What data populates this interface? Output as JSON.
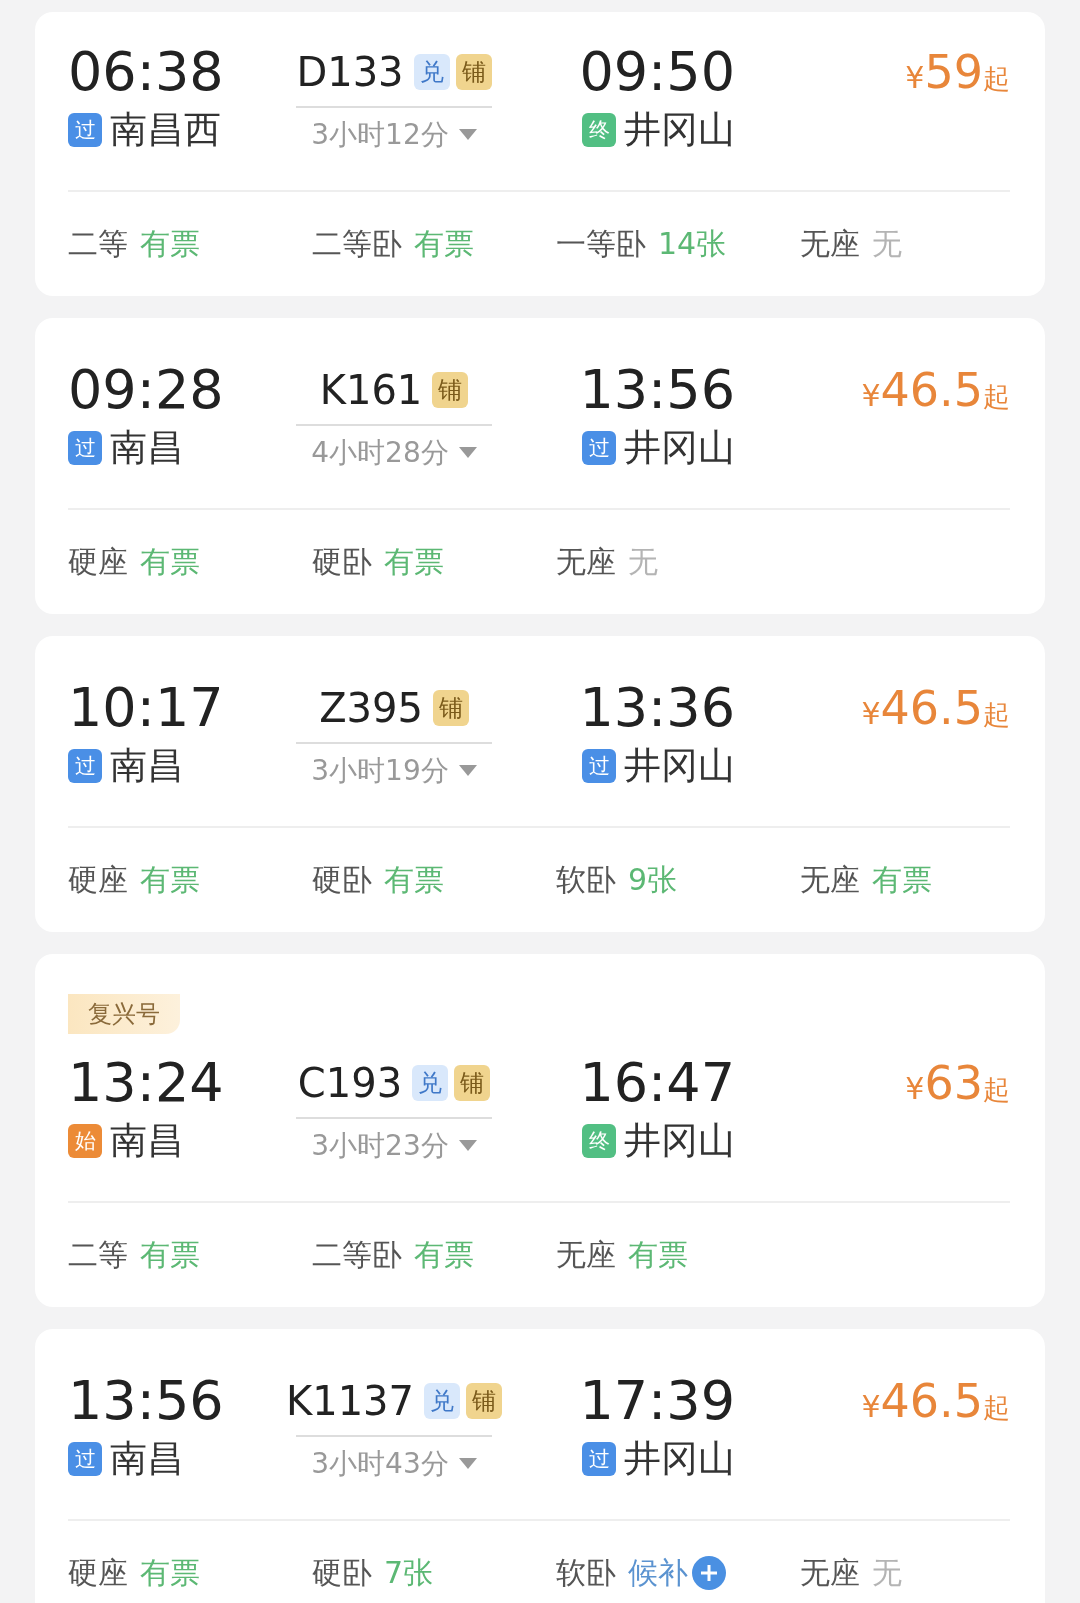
{
  "trains": [
    {
      "depart": "06:38",
      "from": {
        "tag": "过",
        "kind": "pass",
        "name": "南昌西"
      },
      "number": "D133",
      "tags": [
        {
          "text": "兑",
          "kind": "exchange"
        },
        {
          "text": "铺",
          "kind": "berth"
        }
      ],
      "duration": "3小时12分",
      "arrive": "09:50",
      "to": {
        "tag": "终",
        "kind": "terminal",
        "name": "井冈山"
      },
      "price": {
        "currency": "¥",
        "amount": "59",
        "suffix": "起"
      },
      "seats": [
        {
          "class": "二等",
          "status": "有票",
          "kind": "available"
        },
        {
          "class": "二等卧",
          "status": "有票",
          "kind": "available"
        },
        {
          "class": "一等卧",
          "status": "14张",
          "kind": "available"
        },
        {
          "class": "无座",
          "status": "无",
          "kind": "none"
        }
      ]
    },
    {
      "depart": "09:28",
      "from": {
        "tag": "过",
        "kind": "pass",
        "name": "南昌"
      },
      "number": "K161",
      "tags": [
        {
          "text": "铺",
          "kind": "berth"
        }
      ],
      "duration": "4小时28分",
      "arrive": "13:56",
      "to": {
        "tag": "过",
        "kind": "pass",
        "name": "井冈山"
      },
      "price": {
        "currency": "¥",
        "amount": "46.5",
        "suffix": "起"
      },
      "seats": [
        {
          "class": "硬座",
          "status": "有票",
          "kind": "available"
        },
        {
          "class": "硬卧",
          "status": "有票",
          "kind": "available"
        },
        {
          "class": "无座",
          "status": "无",
          "kind": "none"
        }
      ]
    },
    {
      "depart": "10:17",
      "from": {
        "tag": "过",
        "kind": "pass",
        "name": "南昌"
      },
      "number": "Z395",
      "tags": [
        {
          "text": "铺",
          "kind": "berth"
        }
      ],
      "duration": "3小时19分",
      "arrive": "13:36",
      "to": {
        "tag": "过",
        "kind": "pass",
        "name": "井冈山"
      },
      "price": {
        "currency": "¥",
        "amount": "46.5",
        "suffix": "起"
      },
      "seats": [
        {
          "class": "硬座",
          "status": "有票",
          "kind": "available"
        },
        {
          "class": "硬卧",
          "status": "有票",
          "kind": "available"
        },
        {
          "class": "软卧",
          "status": "9张",
          "kind": "available"
        },
        {
          "class": "无座",
          "status": "有票",
          "kind": "available"
        }
      ]
    },
    {
      "badge": "复兴号",
      "depart": "13:24",
      "from": {
        "tag": "始",
        "kind": "origin",
        "name": "南昌"
      },
      "number": "C193",
      "tags": [
        {
          "text": "兑",
          "kind": "exchange"
        },
        {
          "text": "铺",
          "kind": "berth"
        }
      ],
      "duration": "3小时23分",
      "arrive": "16:47",
      "to": {
        "tag": "终",
        "kind": "terminal",
        "name": "井冈山"
      },
      "price": {
        "currency": "¥",
        "amount": "63",
        "suffix": "起"
      },
      "seats": [
        {
          "class": "二等",
          "status": "有票",
          "kind": "available"
        },
        {
          "class": "二等卧",
          "status": "有票",
          "kind": "available"
        },
        {
          "class": "无座",
          "status": "有票",
          "kind": "available"
        }
      ]
    },
    {
      "depart": "13:56",
      "from": {
        "tag": "过",
        "kind": "pass",
        "name": "南昌"
      },
      "number": "K1137",
      "tags": [
        {
          "text": "兑",
          "kind": "exchange"
        },
        {
          "text": "铺",
          "kind": "berth"
        }
      ],
      "duration": "3小时43分",
      "arrive": "17:39",
      "to": {
        "tag": "过",
        "kind": "pass",
        "name": "井冈山"
      },
      "price": {
        "currency": "¥",
        "amount": "46.5",
        "suffix": "起"
      },
      "seats": [
        {
          "class": "硬座",
          "status": "有票",
          "kind": "available"
        },
        {
          "class": "硬卧",
          "status": "7张",
          "kind": "available"
        },
        {
          "class": "软卧",
          "status": "候补",
          "kind": "waitlist"
        },
        {
          "class": "无座",
          "status": "无",
          "kind": "none"
        }
      ]
    }
  ]
}
